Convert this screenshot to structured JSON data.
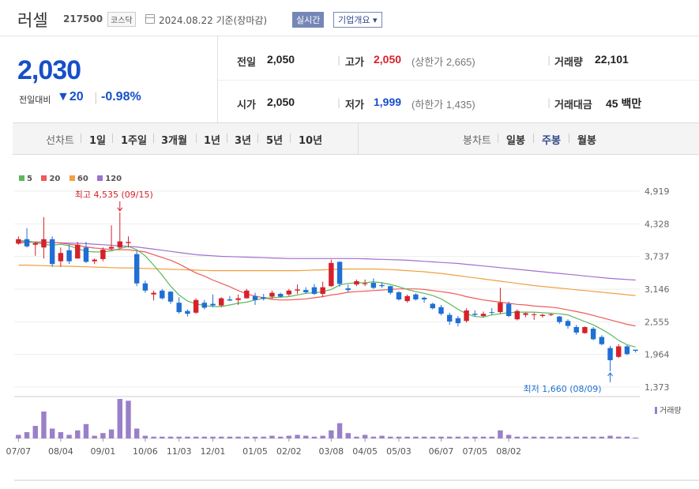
{
  "header": {
    "name": "러셀",
    "code": "217500",
    "market": "코스닥",
    "date": "2024.08.22 기준(장마감)",
    "realtime_label": "실시간",
    "company_label": "기업개요 ▾"
  },
  "summary": {
    "price": "2,030",
    "change_label": "전일대비",
    "change_value": "▼20",
    "change_pct": "-0.98%",
    "prev_close_label": "전일",
    "prev_close": "2,050",
    "open_label": "시가",
    "open": "2,050",
    "high_label": "고가",
    "high": "2,050",
    "upper_limit": "(상한가 2,665)",
    "low_label": "저가",
    "low": "1,999",
    "lower_limit": "(하한가 1,435)",
    "volume_label": "거래량",
    "volume": "22,101",
    "amount_label": "거래대금",
    "amount": "45 백만",
    "colors": {
      "down": "#1650c8",
      "up": "#d5212b"
    }
  },
  "tabs": {
    "line_label": "선차트",
    "line_items": [
      "1일",
      "1주일",
      "3개월",
      "1년",
      "3년",
      "5년",
      "10년"
    ],
    "candle_label": "봉차트",
    "candle_items": [
      "일봉",
      "주봉",
      "월봉"
    ],
    "active": "주봉"
  },
  "chart_data": {
    "type": "candlestick",
    "legend": [
      {
        "name": "5",
        "color": "#5cb85c"
      },
      {
        "name": "20",
        "color": "#f05a5a"
      },
      {
        "name": "60",
        "color": "#f0a040"
      },
      {
        "name": "120",
        "color": "#a070d0"
      }
    ],
    "y_ticks": [
      "4,919",
      "4,328",
      "3,737",
      "3,146",
      "2,555",
      "1,964",
      "1,373"
    ],
    "y_range": [
      1373,
      4919
    ],
    "x_ticks": [
      "07/07",
      "08/04",
      "09/01",
      "10/06",
      "11/03",
      "12/01",
      "01/05",
      "02/02",
      "03/08",
      "04/05",
      "05/03",
      "06/07",
      "07/05",
      "08/02"
    ],
    "max_annotation": "최고 4,535 (09/15)",
    "min_annotation": "최저 1,660 (08/09)",
    "volume_label": "거래량",
    "candles": [
      [
        3970,
        4100,
        3950,
        4050
      ],
      [
        4050,
        4250,
        3900,
        3920
      ],
      [
        3950,
        4000,
        3750,
        3980
      ],
      [
        3900,
        4450,
        3700,
        4050
      ],
      [
        4050,
        4100,
        3550,
        3600
      ],
      [
        3650,
        3900,
        3550,
        3800
      ],
      [
        3850,
        3950,
        3600,
        3650
      ],
      [
        3700,
        4000,
        3700,
        3950
      ],
      [
        3900,
        4000,
        3620,
        3640
      ],
      [
        3650,
        3700,
        3600,
        3680
      ],
      [
        3690,
        3900,
        3650,
        3860
      ],
      [
        3880,
        4300,
        3850,
        3910
      ],
      [
        3900,
        4535,
        3880,
        4010
      ],
      [
        3980,
        4100,
        3900,
        4000
      ],
      [
        3780,
        3830,
        3200,
        3250
      ],
      [
        3250,
        3300,
        3080,
        3120
      ],
      [
        3050,
        3120,
        2940,
        3080
      ],
      [
        3120,
        3150,
        2960,
        2980
      ],
      [
        3100,
        3110,
        2880,
        2920
      ],
      [
        2900,
        3000,
        2700,
        2730
      ],
      [
        2750,
        2780,
        2650,
        2700
      ],
      [
        2720,
        2980,
        2700,
        2950
      ],
      [
        2900,
        2950,
        2780,
        2810
      ],
      [
        2880,
        3050,
        2820,
        2850
      ],
      [
        2850,
        3000,
        2820,
        2980
      ],
      [
        2960,
        3020,
        2930,
        2940
      ],
      [
        2950,
        3050,
        2860,
        2980
      ],
      [
        2980,
        3150,
        2980,
        3120
      ],
      [
        3020,
        3080,
        2860,
        2950
      ],
      [
        3000,
        3060,
        2940,
        2970
      ],
      [
        3010,
        3120,
        2970,
        3080
      ],
      [
        3060,
        3080,
        2990,
        3010
      ],
      [
        3050,
        3150,
        3020,
        3120
      ],
      [
        3120,
        3230,
        3060,
        3140
      ],
      [
        3130,
        3180,
        3060,
        3090
      ],
      [
        3180,
        3240,
        3040,
        3060
      ],
      [
        3060,
        3280,
        3000,
        3180
      ],
      [
        3200,
        3680,
        3190,
        3620
      ],
      [
        3640,
        3650,
        3190,
        3240
      ],
      [
        3160,
        3230,
        3090,
        3130
      ],
      [
        3230,
        3320,
        3200,
        3290
      ],
      [
        3240,
        3320,
        3200,
        3250
      ],
      [
        3260,
        3340,
        3150,
        3170
      ],
      [
        3220,
        3270,
        3170,
        3200
      ],
      [
        3200,
        3210,
        3050,
        3080
      ],
      [
        3090,
        3110,
        2940,
        2960
      ],
      [
        2930,
        3050,
        2900,
        3020
      ],
      [
        3050,
        3070,
        2940,
        2960
      ],
      [
        2990,
        3010,
        2900,
        2960
      ],
      [
        2880,
        2900,
        2780,
        2800
      ],
      [
        2820,
        2860,
        2670,
        2700
      ],
      [
        2680,
        2720,
        2500,
        2560
      ],
      [
        2620,
        2660,
        2470,
        2530
      ],
      [
        2570,
        2800,
        2540,
        2760
      ],
      [
        2700,
        2760,
        2650,
        2680
      ],
      [
        2660,
        2740,
        2630,
        2700
      ],
      [
        2730,
        2800,
        2680,
        2720
      ],
      [
        2730,
        3170,
        2700,
        2900
      ],
      [
        2880,
        2920,
        2640,
        2660
      ],
      [
        2600,
        2780,
        2580,
        2750
      ],
      [
        2680,
        2720,
        2640,
        2710
      ],
      [
        2680,
        2720,
        2590,
        2690
      ],
      [
        2660,
        2700,
        2630,
        2680
      ],
      [
        2680,
        2710,
        2660,
        2690
      ],
      [
        2650,
        2660,
        2520,
        2550
      ],
      [
        2570,
        2600,
        2430,
        2480
      ],
      [
        2460,
        2500,
        2320,
        2360
      ],
      [
        2350,
        2470,
        2340,
        2460
      ],
      [
        2430,
        2460,
        2220,
        2240
      ],
      [
        2280,
        2310,
        2130,
        2150
      ],
      [
        2080,
        2120,
        1660,
        1860
      ],
      [
        1920,
        2150,
        1900,
        2110
      ],
      [
        2110,
        2130,
        1950,
        1970
      ],
      [
        2050,
        2050,
        1999,
        2030
      ]
    ],
    "ma5": [
      4020,
      4020,
      3990,
      3960,
      3940,
      3960,
      3930,
      3880,
      3830,
      3820,
      3820,
      3840,
      3880,
      3920,
      3860,
      3750,
      3580,
      3400,
      3200,
      3040,
      2930,
      2880,
      2850,
      2830,
      2830,
      2860,
      2890,
      2910,
      2950,
      2980,
      2990,
      3000,
      3010,
      3040,
      3070,
      3080,
      3100,
      3140,
      3220,
      3250,
      3260,
      3260,
      3280,
      3260,
      3230,
      3190,
      3140,
      3100,
      3070,
      3030,
      2970,
      2880,
      2780,
      2700,
      2650,
      2640,
      2680,
      2700,
      2720,
      2730,
      2730,
      2730,
      2720,
      2710,
      2700,
      2680,
      2620,
      2560,
      2500,
      2420,
      2330,
      2220,
      2140,
      2100
    ],
    "ma20": [
      3980,
      3990,
      4000,
      4000,
      3990,
      3980,
      3960,
      3940,
      3910,
      3890,
      3880,
      3860,
      3860,
      3860,
      3840,
      3820,
      3770,
      3720,
      3670,
      3600,
      3520,
      3440,
      3380,
      3310,
      3250,
      3190,
      3120,
      3060,
      3020,
      2990,
      2960,
      2950,
      2950,
      2960,
      2970,
      2990,
      3010,
      3040,
      3060,
      3090,
      3100,
      3110,
      3120,
      3130,
      3140,
      3150,
      3150,
      3150,
      3140,
      3120,
      3100,
      3080,
      3050,
      3010,
      2980,
      2950,
      2930,
      2910,
      2890,
      2870,
      2860,
      2840,
      2830,
      2820,
      2800,
      2770,
      2740,
      2710,
      2670,
      2630,
      2590,
      2550,
      2510,
      2480
    ],
    "ma60": [
      3580,
      3580,
      3575,
      3570,
      3565,
      3560,
      3560,
      3555,
      3550,
      3545,
      3540,
      3535,
      3530,
      3530,
      3525,
      3520,
      3515,
      3510,
      3505,
      3500,
      3495,
      3490,
      3485,
      3480,
      3480,
      3480,
      3480,
      3480,
      3480,
      3480,
      3480,
      3480,
      3480,
      3480,
      3485,
      3490,
      3495,
      3500,
      3505,
      3510,
      3510,
      3510,
      3510,
      3505,
      3500,
      3490,
      3480,
      3470,
      3460,
      3445,
      3430,
      3410,
      3390,
      3370,
      3350,
      3330,
      3310,
      3290,
      3270,
      3250,
      3230,
      3210,
      3195,
      3180,
      3165,
      3150,
      3135,
      3120,
      3105,
      3090,
      3075,
      3060,
      3045,
      3030
    ],
    "ma120": [
      4010,
      4005,
      4000,
      3995,
      3990,
      3985,
      3980,
      3975,
      3970,
      3960,
      3950,
      3940,
      3930,
      3920,
      3910,
      3890,
      3870,
      3850,
      3830,
      3810,
      3790,
      3770,
      3760,
      3750,
      3740,
      3735,
      3730,
      3725,
      3720,
      3715,
      3710,
      3705,
      3700,
      3700,
      3700,
      3700,
      3700,
      3700,
      3700,
      3700,
      3700,
      3695,
      3690,
      3685,
      3680,
      3675,
      3670,
      3660,
      3650,
      3640,
      3630,
      3620,
      3610,
      3595,
      3580,
      3565,
      3550,
      3535,
      3520,
      3505,
      3490,
      3475,
      3460,
      3445,
      3430,
      3415,
      3400,
      3385,
      3370,
      3355,
      3340,
      3330,
      3320,
      3310
    ],
    "volume": [
      4,
      7,
      14,
      30,
      11,
      7,
      4,
      9,
      16,
      3,
      6,
      10,
      44,
      42,
      11,
      3,
      2,
      2,
      2,
      2,
      2,
      2,
      2,
      2,
      2,
      2,
      2,
      2,
      2,
      2,
      3,
      2,
      3,
      4,
      3,
      2,
      3,
      9,
      17,
      6,
      2,
      4,
      2,
      3,
      2,
      2,
      2,
      2,
      2,
      2,
      2,
      2,
      2,
      2,
      2,
      2,
      2,
      9,
      4,
      2,
      2,
      2,
      2,
      2,
      2,
      2,
      2,
      2,
      2,
      2,
      3,
      2,
      2,
      1
    ]
  }
}
